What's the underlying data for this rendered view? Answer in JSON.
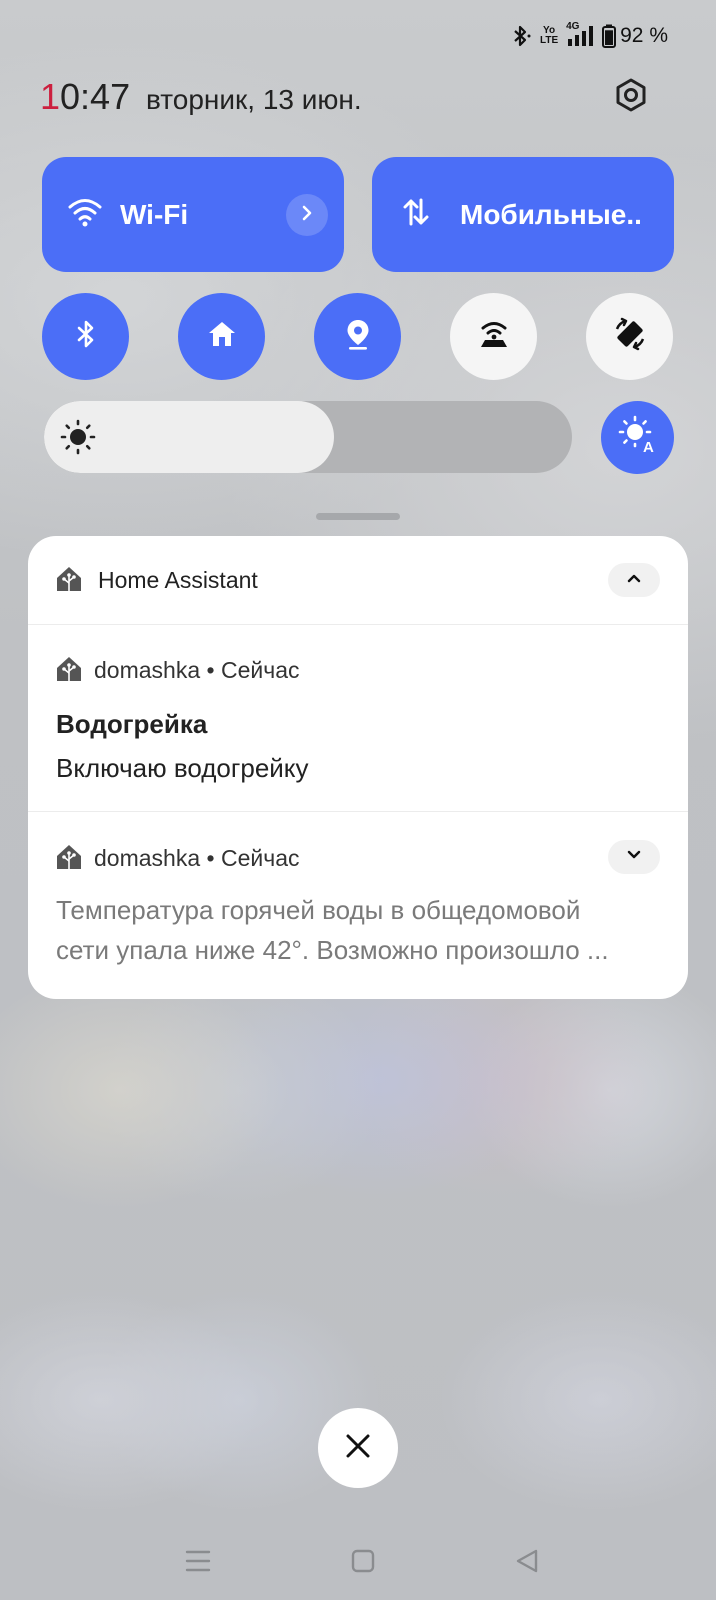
{
  "status_bar": {
    "battery_percent": "92 %",
    "battery_level": 0.92,
    "volte_top": "Yo",
    "volte_bottom": "LTE",
    "network_type": "4G",
    "icons": [
      "bluetooth-icon",
      "volte-icon",
      "signal-icon",
      "battery-icon"
    ]
  },
  "header": {
    "time_first_digit": "1",
    "time_rest": "0:47",
    "date": "вторник, 13 июн.",
    "settings_icon": "settings-hexagon-icon"
  },
  "quick_tiles": {
    "wifi": {
      "label": "Wi-Fi",
      "icon": "wifi-icon",
      "expand_icon": "chevron-right-icon",
      "state": "on"
    },
    "mobile": {
      "label": "Мобильные..",
      "icon": "mobile-data-arrows-icon",
      "state": "on"
    }
  },
  "toggles": [
    {
      "name": "bluetooth",
      "icon": "bluetooth-icon",
      "state": "on"
    },
    {
      "name": "home",
      "icon": "home-icon",
      "state": "on"
    },
    {
      "name": "location",
      "icon": "location-pin-icon",
      "state": "on"
    },
    {
      "name": "hotspot",
      "icon": "hotspot-icon",
      "state": "off"
    },
    {
      "name": "auto-rotate",
      "icon": "rotate-icon",
      "state": "off"
    }
  ],
  "brightness": {
    "level": 0.55,
    "icon": "sun-icon",
    "auto_icon": "auto-brightness-icon",
    "auto_state": "on"
  },
  "notification_group": {
    "app_name": "Home Assistant",
    "app_icon": "home-assistant-icon",
    "collapse_icon": "chevron-up-icon",
    "notifications": [
      {
        "source": "domashka",
        "separator": "•",
        "time": "Сейчас",
        "title": "Водогрейка",
        "text": "Включаю водогрейку"
      },
      {
        "source": "domashka",
        "separator": "•",
        "time": "Сейчас",
        "expand_icon": "chevron-down-icon",
        "body_line1": "Температура горячей воды в общедомовой",
        "body_line2": "сети упала ниже 42°. Возможно произошло ..."
      }
    ]
  },
  "close_button": {
    "icon": "close-icon"
  },
  "nav_bar": {
    "icons": [
      "menu-icon",
      "home-square-icon",
      "back-triangle-icon"
    ]
  },
  "colors": {
    "accent": "#4b6ef7",
    "time_first_digit": "#cc1f3e",
    "toggle_off": "#f5f5f5",
    "card": "#ffffff"
  }
}
